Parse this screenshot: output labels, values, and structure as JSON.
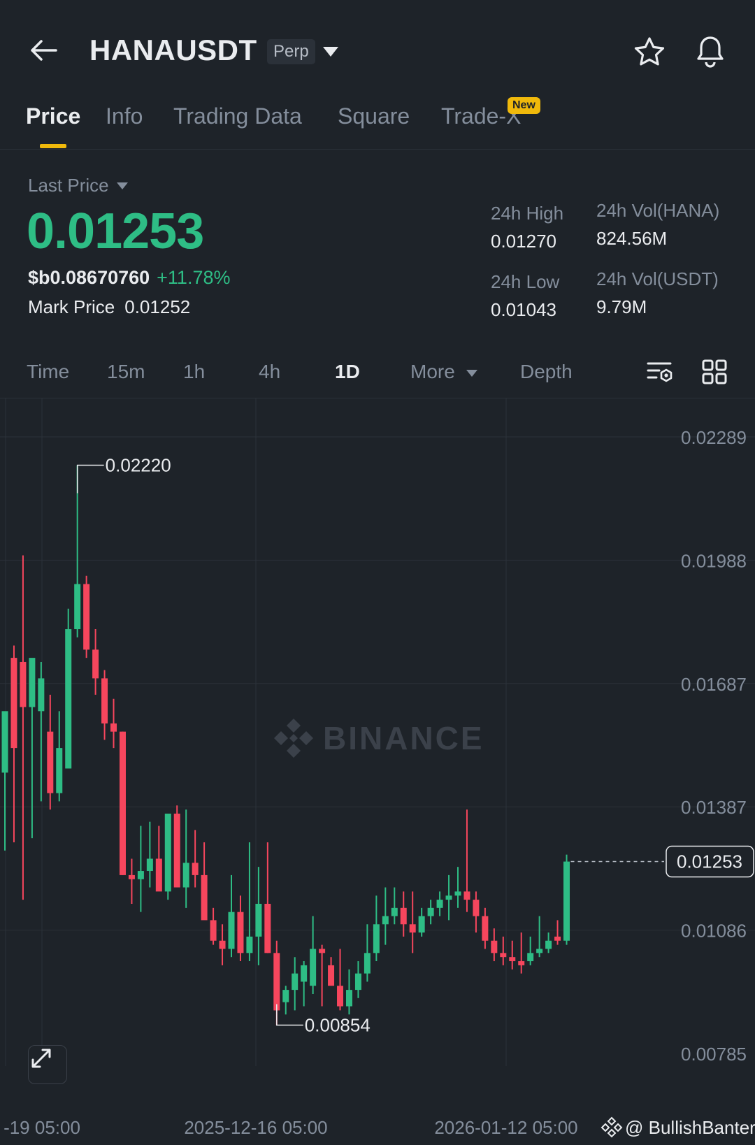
{
  "header": {
    "symbol": "HANAUSDT",
    "contract_type": "Perp",
    "icons": {
      "back": "arrow-left-icon",
      "caret": "caret-down-icon",
      "favorite": "star-icon",
      "alert": "bell-icon"
    }
  },
  "tabs": [
    {
      "label": "Price",
      "active": true
    },
    {
      "label": "Info",
      "active": false
    },
    {
      "label": "Trading Data",
      "active": false
    },
    {
      "label": "Square",
      "active": false
    },
    {
      "label": "Trade-X",
      "active": false,
      "badge": "New"
    }
  ],
  "stats": {
    "last_price_label": "Last Price",
    "last_price": "0.01253",
    "usd_price": "$b0.08670760",
    "change_pct": "+11.78%",
    "mark_price_label": "Mark Price",
    "mark_price": "0.01252",
    "high_label": "24h High",
    "high": "0.01270",
    "low_label": "24h Low",
    "low": "0.01043",
    "vol_base_label": "24h Vol(HANA)",
    "vol_base": "824.56M",
    "vol_quote_label": "24h Vol(USDT)",
    "vol_quote": "9.79M"
  },
  "intervals": {
    "items": [
      "Time",
      "15m",
      "1h",
      "4h",
      "1D",
      "More",
      "Depth"
    ],
    "active": "1D",
    "icons": [
      "indicator-settings-icon",
      "grid-layout-icon"
    ]
  },
  "colors": {
    "up": "#2ebd85",
    "down": "#f6465d",
    "accent": "#f0b90b",
    "bg": "#1e2329"
  },
  "chart_data": {
    "type": "candlestick",
    "watermark": "BINANCE",
    "attribution": "@ BullishBanter",
    "y_ticks": [
      "0.02289",
      "0.01988",
      "0.01687",
      "0.01387",
      "0.01086",
      "0.00785"
    ],
    "x_ticks": [
      "-19 05:00",
      "2025-12-16 05:00",
      "2026-01-12 05:00"
    ],
    "ylim": [
      0.00785,
      0.02289
    ],
    "current_price": "0.01253",
    "max_marker": {
      "label": "0.02220",
      "value": 0.0222
    },
    "min_marker": {
      "label": "0.00854",
      "value": 0.00854
    },
    "candles": [
      {
        "o": 0.0147,
        "h": 0.0157,
        "l": 0.0128,
        "c": 0.0162
      },
      {
        "o": 0.0175,
        "h": 0.0178,
        "l": 0.013,
        "c": 0.0153
      },
      {
        "o": 0.0174,
        "h": 0.02,
        "l": 0.0116,
        "c": 0.0163
      },
      {
        "o": 0.0163,
        "h": 0.0168,
        "l": 0.0131,
        "c": 0.0175
      },
      {
        "o": 0.0162,
        "h": 0.0174,
        "l": 0.014,
        "c": 0.017
      },
      {
        "o": 0.0157,
        "h": 0.0166,
        "l": 0.0138,
        "c": 0.0142
      },
      {
        "o": 0.0142,
        "h": 0.0162,
        "l": 0.014,
        "c": 0.0153
      },
      {
        "o": 0.0148,
        "h": 0.0187,
        "l": 0.015,
        "c": 0.0182
      },
      {
        "o": 0.0182,
        "h": 0.0222,
        "l": 0.018,
        "c": 0.0193
      },
      {
        "o": 0.0193,
        "h": 0.0195,
        "l": 0.0175,
        "c": 0.0177
      },
      {
        "o": 0.0177,
        "h": 0.0182,
        "l": 0.0166,
        "c": 0.017
      },
      {
        "o": 0.017,
        "h": 0.0172,
        "l": 0.0155,
        "c": 0.0159
      },
      {
        "o": 0.0159,
        "h": 0.0165,
        "l": 0.0153,
        "c": 0.0157
      },
      {
        "o": 0.0157,
        "h": 0.0157,
        "l": 0.0122,
        "c": 0.0122
      },
      {
        "o": 0.0122,
        "h": 0.0126,
        "l": 0.0115,
        "c": 0.0121
      },
      {
        "o": 0.0121,
        "h": 0.0134,
        "l": 0.0113,
        "c": 0.0123
      },
      {
        "o": 0.0123,
        "h": 0.0135,
        "l": 0.0119,
        "c": 0.0126
      },
      {
        "o": 0.0126,
        "h": 0.0134,
        "l": 0.0119,
        "c": 0.0118
      },
      {
        "o": 0.0118,
        "h": 0.0135,
        "l": 0.0116,
        "c": 0.0137
      },
      {
        "o": 0.0137,
        "h": 0.0139,
        "l": 0.0119,
        "c": 0.0119
      },
      {
        "o": 0.0119,
        "h": 0.0138,
        "l": 0.0114,
        "c": 0.0125
      },
      {
        "o": 0.0125,
        "h": 0.0133,
        "l": 0.0119,
        "c": 0.0122
      },
      {
        "o": 0.0122,
        "h": 0.013,
        "l": 0.0112,
        "c": 0.0111
      },
      {
        "o": 0.0111,
        "h": 0.0114,
        "l": 0.0105,
        "c": 0.0106
      },
      {
        "o": 0.0106,
        "h": 0.011,
        "l": 0.01,
        "c": 0.0104
      },
      {
        "o": 0.0104,
        "h": 0.0122,
        "l": 0.0102,
        "c": 0.0113
      },
      {
        "o": 0.0113,
        "h": 0.0117,
        "l": 0.0101,
        "c": 0.0103
      },
      {
        "o": 0.0103,
        "h": 0.013,
        "l": 0.0101,
        "c": 0.0107
      },
      {
        "o": 0.0107,
        "h": 0.0124,
        "l": 0.01,
        "c": 0.0115
      },
      {
        "o": 0.0115,
        "h": 0.013,
        "l": 0.0103,
        "c": 0.0103
      },
      {
        "o": 0.0103,
        "h": 0.0106,
        "l": 0.00854,
        "c": 0.0089
      },
      {
        "o": 0.0091,
        "h": 0.0095,
        "l": 0.0088,
        "c": 0.0094
      },
      {
        "o": 0.0094,
        "h": 0.0102,
        "l": 0.0089,
        "c": 0.0098
      },
      {
        "o": 0.0096,
        "h": 0.0101,
        "l": 0.009,
        "c": 0.01
      },
      {
        "o": 0.0095,
        "h": 0.0112,
        "l": 0.0093,
        "c": 0.0104
      },
      {
        "o": 0.0104,
        "h": 0.0105,
        "l": 0.009,
        "c": 0.0103
      },
      {
        "o": 0.01,
        "h": 0.0102,
        "l": 0.0096,
        "c": 0.0095
      },
      {
        "o": 0.0095,
        "h": 0.0104,
        "l": 0.0089,
        "c": 0.009
      },
      {
        "o": 0.009,
        "h": 0.0099,
        "l": 0.0088,
        "c": 0.0094
      },
      {
        "o": 0.0094,
        "h": 0.0101,
        "l": 0.0092,
        "c": 0.0098
      },
      {
        "o": 0.0098,
        "h": 0.011,
        "l": 0.0096,
        "c": 0.0103
      },
      {
        "o": 0.0103,
        "h": 0.0117,
        "l": 0.0101,
        "c": 0.011
      },
      {
        "o": 0.011,
        "h": 0.0119,
        "l": 0.0105,
        "c": 0.0112
      },
      {
        "o": 0.0112,
        "h": 0.0119,
        "l": 0.011,
        "c": 0.0114
      },
      {
        "o": 0.0114,
        "h": 0.0118,
        "l": 0.0107,
        "c": 0.011
      },
      {
        "o": 0.011,
        "h": 0.0118,
        "l": 0.0103,
        "c": 0.0108
      },
      {
        "o": 0.0108,
        "h": 0.0114,
        "l": 0.0107,
        "c": 0.0112
      },
      {
        "o": 0.0112,
        "h": 0.0116,
        "l": 0.011,
        "c": 0.0114
      },
      {
        "o": 0.0114,
        "h": 0.0118,
        "l": 0.0112,
        "c": 0.0116
      },
      {
        "o": 0.0116,
        "h": 0.0122,
        "l": 0.0111,
        "c": 0.0117
      },
      {
        "o": 0.0117,
        "h": 0.0124,
        "l": 0.0114,
        "c": 0.0118
      },
      {
        "o": 0.0118,
        "h": 0.0138,
        "l": 0.0113,
        "c": 0.0116
      },
      {
        "o": 0.0116,
        "h": 0.0118,
        "l": 0.0108,
        "c": 0.0112
      },
      {
        "o": 0.0112,
        "h": 0.0114,
        "l": 0.0104,
        "c": 0.0106
      },
      {
        "o": 0.0106,
        "h": 0.0109,
        "l": 0.0101,
        "c": 0.0103
      },
      {
        "o": 0.0103,
        "h": 0.0107,
        "l": 0.01,
        "c": 0.0102
      },
      {
        "o": 0.0102,
        "h": 0.0106,
        "l": 0.0099,
        "c": 0.0101
      },
      {
        "o": 0.0101,
        "h": 0.0108,
        "l": 0.0098,
        "c": 0.01
      },
      {
        "o": 0.0101,
        "h": 0.0107,
        "l": 0.01,
        "c": 0.0103
      },
      {
        "o": 0.0103,
        "h": 0.0112,
        "l": 0.0102,
        "c": 0.0104
      },
      {
        "o": 0.0104,
        "h": 0.0108,
        "l": 0.0103,
        "c": 0.0106
      },
      {
        "o": 0.0107,
        "h": 0.0111,
        "l": 0.0105,
        "c": 0.0106
      },
      {
        "o": 0.0106,
        "h": 0.0127,
        "l": 0.0105,
        "c": 0.01253
      }
    ]
  }
}
